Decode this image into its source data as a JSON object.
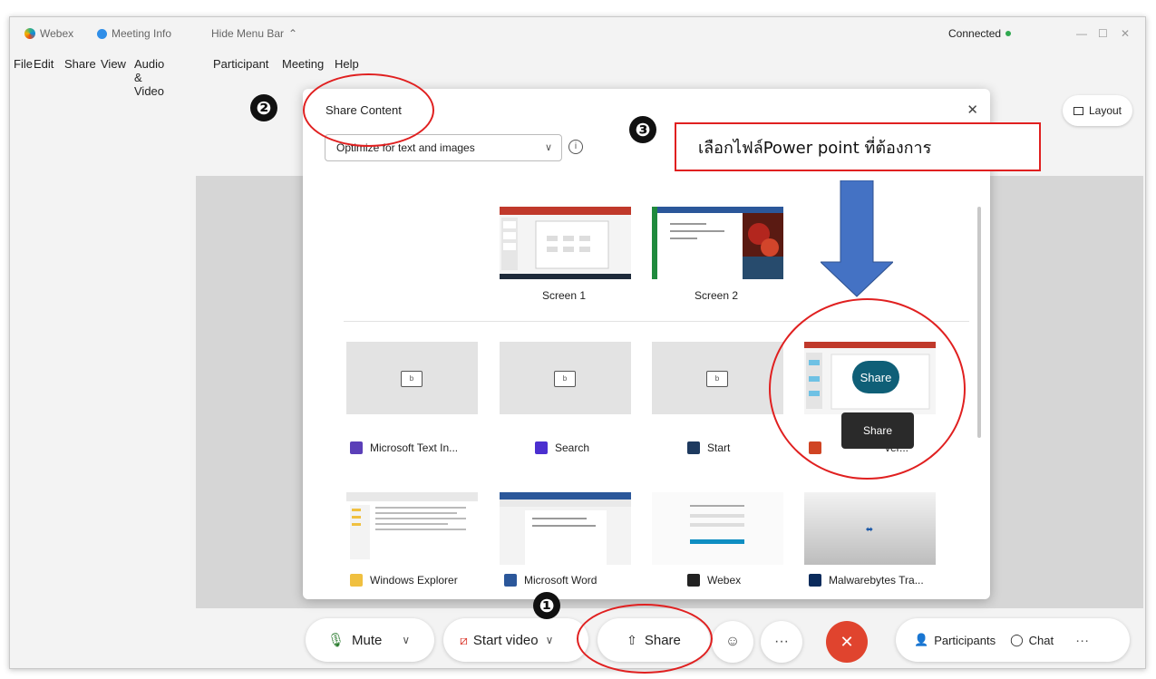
{
  "titlebar": {
    "app": "Webex",
    "meeting_info": "Meeting Info",
    "hide_menu": "Hide Menu Bar",
    "status": "Connected"
  },
  "menu": [
    "File",
    "Edit",
    "Share",
    "View",
    "Audio & Video",
    "Participant",
    "Meeting",
    "Help"
  ],
  "layout_label": "Layout",
  "dialog": {
    "title": "Share Content",
    "optimize": "Optimize for text and images",
    "screens": [
      {
        "label": "Screen 1"
      },
      {
        "label": "Screen 2"
      }
    ],
    "apps_row1": [
      {
        "label": "Microsoft Text In...",
        "icon": "text-input-app-icon"
      },
      {
        "label": "Search",
        "icon": "search-app-icon"
      },
      {
        "label": "Start",
        "icon": "start-app-icon"
      },
      {
        "label": "ver...",
        "icon": "powerpoint-app-icon"
      }
    ],
    "apps_row2": [
      {
        "label": "Windows Explorer",
        "icon": "explorer-app-icon"
      },
      {
        "label": "Microsoft Word",
        "icon": "word-app-icon"
      },
      {
        "label": "Webex",
        "icon": "webex-app-icon"
      },
      {
        "label": "Malwarebytes Tra...",
        "icon": "malwarebytes-app-icon"
      }
    ],
    "share_button": "Share",
    "share_tooltip": "Share"
  },
  "callout_text": "เลือกไฟล์Power point ที่ต้องการ",
  "toolbar": {
    "mute": "Mute",
    "start_video": "Start video",
    "share": "Share",
    "participants": "Participants",
    "chat": "Chat"
  },
  "markers": [
    "❶",
    "❷",
    "❸"
  ],
  "colors": {
    "annotation_red": "#e02020",
    "arrow_blue": "#4472c4",
    "end_red": "#e0442e",
    "share_teal": "#0f5f77"
  }
}
